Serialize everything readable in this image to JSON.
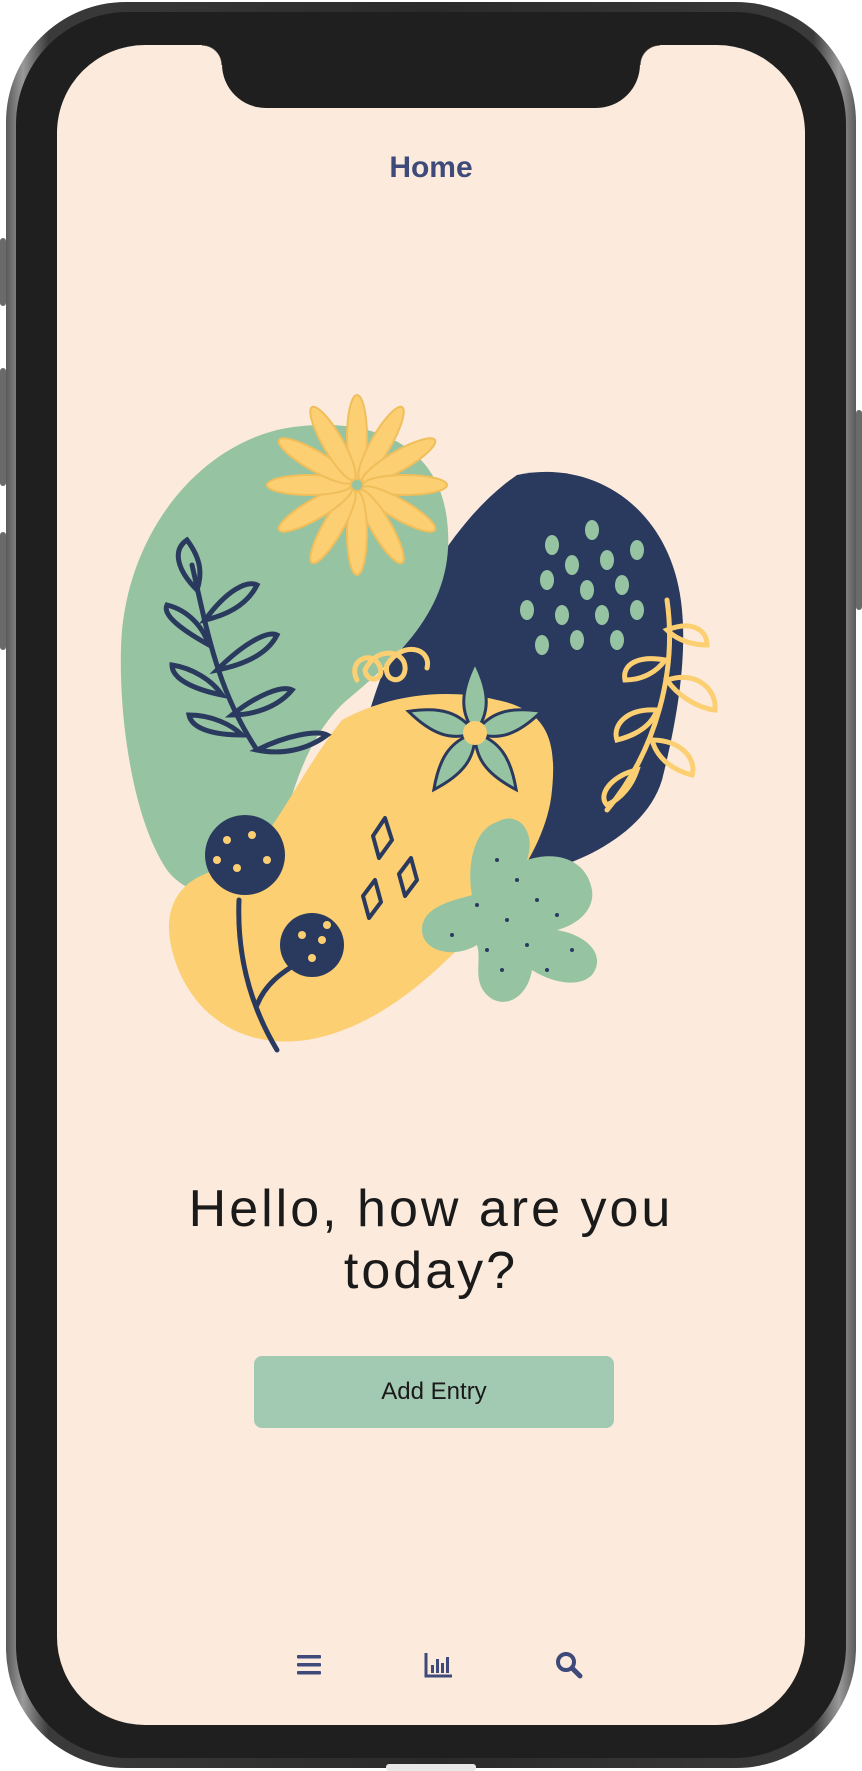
{
  "header": {
    "title": "Home"
  },
  "main": {
    "greeting": "Hello, how are you today?",
    "add_entry_label": "Add Entry"
  },
  "bottom_nav": {
    "items": [
      {
        "icon": "menu-icon"
      },
      {
        "icon": "stats-chart-icon"
      },
      {
        "icon": "search-icon"
      }
    ]
  },
  "colors": {
    "background": "#fcebdc",
    "accent_green": "#a2c9b2",
    "navy": "#3d4a7a",
    "dark_navy": "#2a3a5e",
    "mustard": "#fccf72",
    "sage": "#96c4a2"
  }
}
